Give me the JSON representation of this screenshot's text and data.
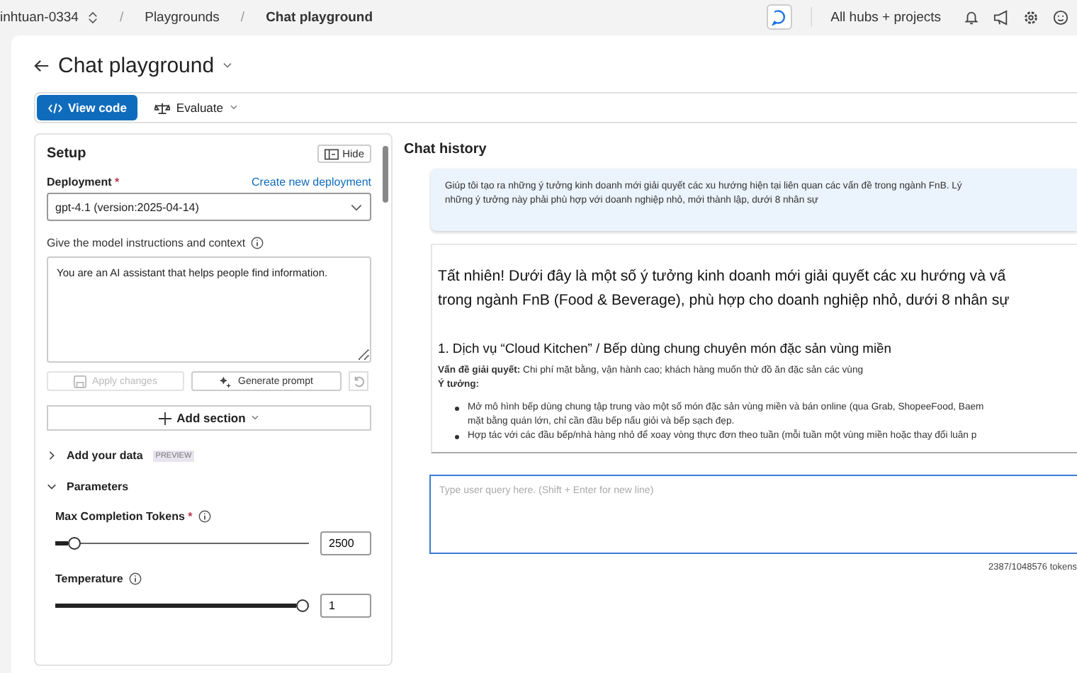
{
  "breadcrumb": [
    {
      "label": "inhtuan-0334",
      "kind": "switcher"
    },
    {
      "label": "Playgrounds",
      "kind": "link"
    },
    {
      "label": "Chat playground",
      "kind": "current"
    }
  ],
  "topbar": {
    "scope": "All hubs + projects",
    "separator": "/"
  },
  "page": {
    "title": "Chat playground"
  },
  "toolbar": {
    "view_code": "View code",
    "evaluate": "Evaluate"
  },
  "setup": {
    "title": "Setup",
    "hide": "Hide",
    "deployment_label": "Deployment",
    "required": "*",
    "create_link": "Create new deployment",
    "deployment_value": "gpt-4.1 (version:2025-04-14)",
    "instructions_label": "Give the model instructions and context",
    "instructions": "You are an AI assistant that helps people find information.",
    "apply": {
      "label": "Apply changes",
      "disabled": true
    },
    "generate": {
      "label": "Generate prompt",
      "disabled": false
    },
    "add_section": "Add section",
    "sections": [
      {
        "label": "Add your data",
        "badge": "PREVIEW",
        "expanded": false
      },
      {
        "label": "Parameters",
        "expanded": true
      }
    ],
    "params": [
      {
        "label": "Max Completion Tokens",
        "required": true,
        "level": 0.05,
        "value": "2500"
      },
      {
        "label": "Temperature",
        "required": false,
        "level": 1.0,
        "value": "1"
      }
    ]
  },
  "chat": {
    "title": "Chat history",
    "user_message": [
      "Giúp tôi tạo ra những ý tưởng kinh doanh mới giải quyết các xu hướng hiện tại liên quan các vấn đề trong ngành FnB. Lý",
      "những ý tưởng này phải phù hợp với doanh nghiệp nhỏ, mới thành lập, dưới 8 nhân sự"
    ],
    "reply_intro": [
      "Tất nhiên! Dưới đây là một số ý tưởng kinh doanh mới giải quyết các xu hướng và vấ",
      "trong ngành FnB (Food & Beverage), phù hợp cho doanh nghiệp nhỏ, dưới 8 nhân sự"
    ],
    "reply_heading": "1. Dịch vụ “Cloud Kitchen” / Bếp dùng chung chuyên món đặc sản vùng miền",
    "problem": "**Vấn đề giải quyết:** Chi phí mặt bằng, vận hành cao; khách hàng muốn thử đồ ăn đặc sản các vùng",
    "idea_label": "Ý tưởng:",
    "bullets": [
      [
        "Mở mô hình bếp dùng chung tập trung vào một số món đặc sản vùng miền và bán online (qua Grab, ShopeeFood, Baem",
        "mặt bằng quán lớn, chỉ cần đầu bếp nấu giỏi và bếp sạch đẹp."
      ],
      [
        "Hợp tác với các đầu bếp/nhà hàng nhỏ để xoay vòng thực đơn theo tuần (mỗi tuần một vùng miền hoặc thay đổi luân p"
      ]
    ],
    "input_placeholder": "Type user query here. (Shift + Enter for new line)",
    "tokens": "2387/1048576 tokens"
  }
}
